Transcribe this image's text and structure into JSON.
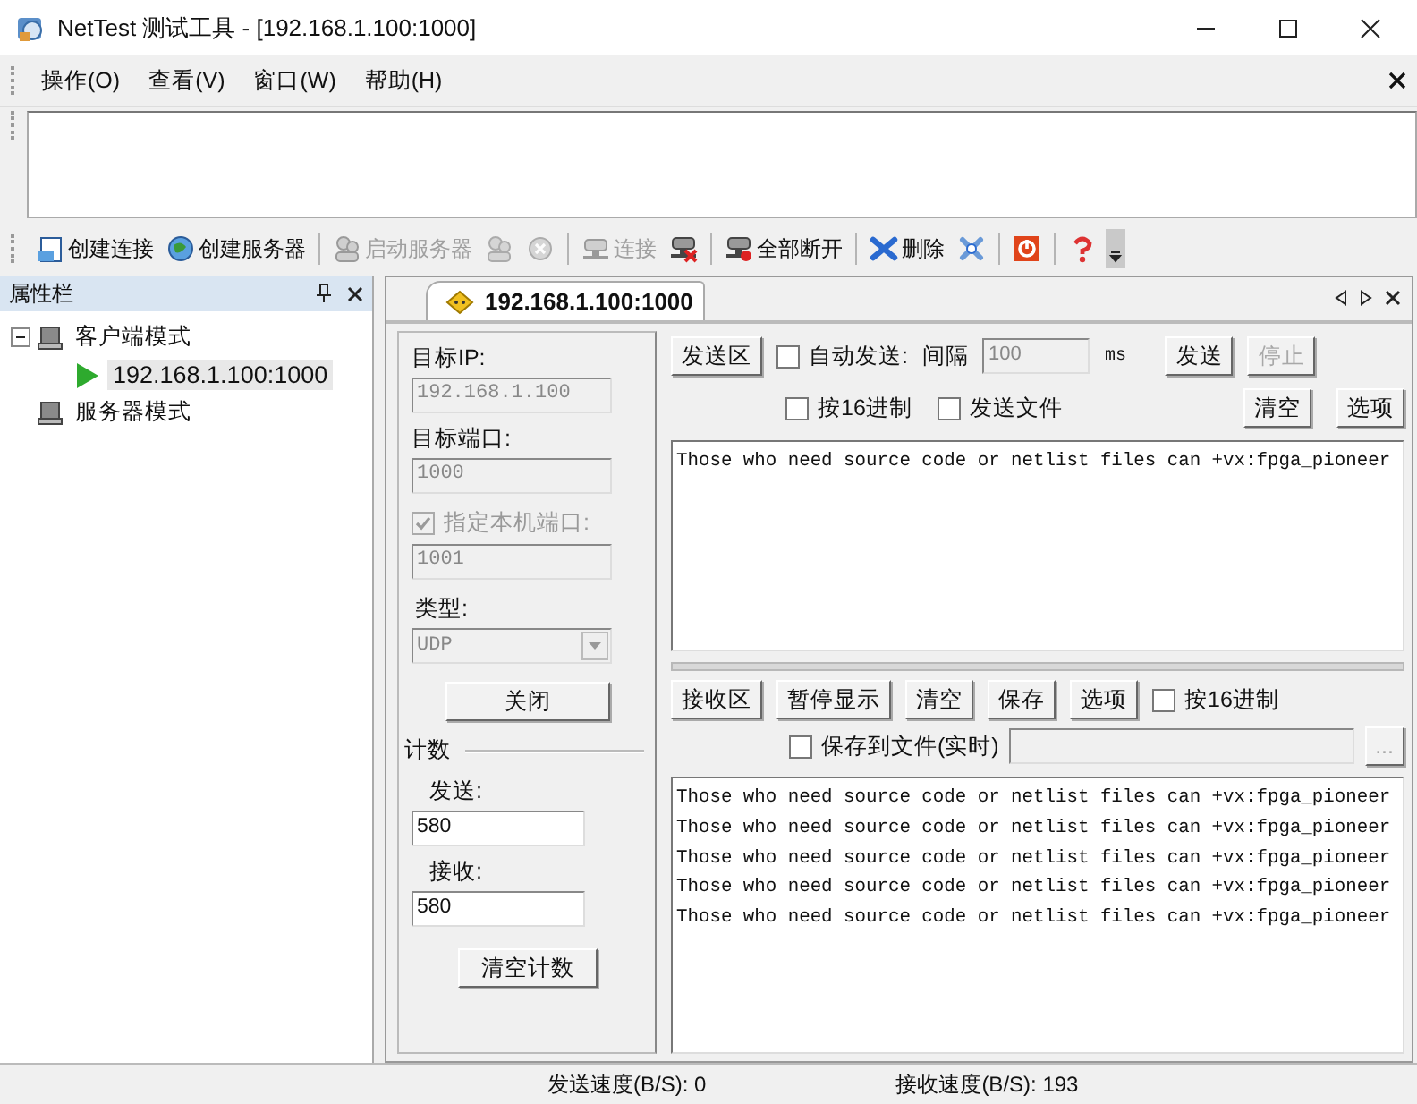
{
  "window": {
    "title": "NetTest 测试工具 - [192.168.1.100:1000]"
  },
  "menu": [
    {
      "label": "操作(O)"
    },
    {
      "label": "查看(V)"
    },
    {
      "label": "窗口(W)"
    },
    {
      "label": "帮助(H)"
    }
  ],
  "toolbar": [
    {
      "kind": "button",
      "label": "创建连接",
      "disabled": false
    },
    {
      "kind": "button",
      "label": "创建服务器",
      "disabled": false
    },
    {
      "kind": "separator"
    },
    {
      "kind": "button",
      "label": "启动服务器",
      "disabled": true
    },
    {
      "kind": "icon",
      "disabled": true
    },
    {
      "kind": "icon",
      "disabled": true
    },
    {
      "kind": "separator"
    },
    {
      "kind": "button",
      "label": "连接",
      "disabled": true
    },
    {
      "kind": "icon",
      "disabled": false
    },
    {
      "kind": "separator"
    },
    {
      "kind": "button",
      "label": "全部断开",
      "disabled": false
    },
    {
      "kind": "separator"
    },
    {
      "kind": "button",
      "label": "删除",
      "disabled": false
    },
    {
      "kind": "icon",
      "disabled": false
    },
    {
      "kind": "separator"
    },
    {
      "kind": "icon",
      "disabled": false
    },
    {
      "kind": "separator"
    },
    {
      "kind": "icon",
      "disabled": false
    }
  ],
  "sidebar": {
    "title": "属性栏",
    "tree": [
      {
        "label": "客户端模式",
        "expanded": true,
        "selected": false,
        "children": [
          {
            "label": "192.168.1.100:1000",
            "selected": true
          }
        ]
      },
      {
        "label": "服务器模式",
        "selected": false
      }
    ]
  },
  "tabs": [
    {
      "label": "192.168.1.100:1000",
      "selected": true
    }
  ],
  "settings": {
    "target_ip": {
      "label": "目标IP:",
      "value": "192.168.1.100",
      "disabled": true
    },
    "target_port": {
      "label": "目标端口:",
      "value": "1000",
      "disabled": true
    },
    "local_port": {
      "label": "指定本机端口:",
      "checked": true,
      "disabled": true,
      "value": "1001"
    },
    "type": {
      "label": "类型:",
      "value": "UDP",
      "disabled": true
    },
    "close_button": "关闭",
    "count": {
      "title": "计数",
      "sent_label": "发送:",
      "sent": "580",
      "received_label": "接收:",
      "received": "580",
      "clear_button": "清空计数"
    }
  },
  "send": {
    "area_button": "发送区",
    "auto_send": {
      "label": "自动发送:",
      "checked": false
    },
    "interval_label": "间隔",
    "interval": {
      "value": "100",
      "disabled": true
    },
    "interval_unit": "ms",
    "send_button": {
      "label": "发送",
      "disabled": false
    },
    "stop_button": {
      "label": "停止",
      "disabled": true
    },
    "hex": {
      "label": "按16进制",
      "checked": false
    },
    "send_file": {
      "label": "发送文件",
      "checked": false
    },
    "clear_button": {
      "label": "清空",
      "disabled": false
    },
    "options_button": {
      "label": "选项",
      "disabled": false
    },
    "text": "Those who need source code or netlist files can +vx:fpga_pioneer"
  },
  "receive": {
    "buttons": [
      {
        "label": "接收区",
        "disabled": false
      },
      {
        "label": "暂停显示",
        "disabled": false
      },
      {
        "label": "清空",
        "disabled": false
      },
      {
        "label": "保存",
        "disabled": false
      },
      {
        "label": "选项",
        "disabled": false
      }
    ],
    "hex": {
      "label": "按16进制",
      "checked": false
    },
    "save_to_file": {
      "label": "保存到文件(实时)",
      "checked": false
    },
    "file_field": {
      "disabled": true
    },
    "browse_button": {
      "label": "...",
      "disabled": true
    },
    "lines": [
      "Those who need source code or netlist files can +vx:fpga_pioneer",
      "Those who need source code or netlist files can +vx:fpga_pioneer",
      "Those who need source code or netlist files can +vx:fpga_pioneer",
      "Those who need source code or netlist files can +vx:fpga_pioneer",
      "Those who need source code or netlist files can +vx:fpga_pioneer"
    ]
  },
  "status_bar": {
    "send_speed": "发送速度(B/S): 0",
    "receive_speed": "接收速度(B/S): 193"
  }
}
